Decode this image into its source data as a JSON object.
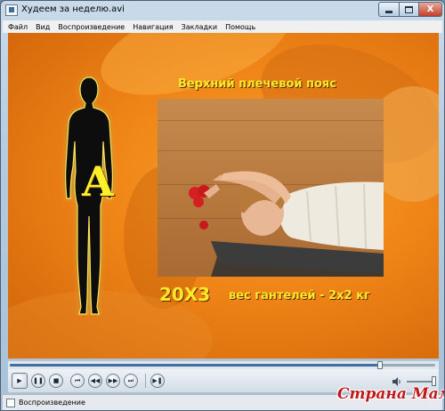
{
  "window": {
    "title": "Худеем за неделю.avi",
    "buttons": {
      "minimize": "—",
      "maximize": "□",
      "close": "X"
    }
  },
  "menu": {
    "items": [
      "Файл",
      "Вид",
      "Воспроизведение",
      "Навигация",
      "Закладки",
      "Помощь"
    ]
  },
  "video": {
    "heading": "Верхний плечевой пояс",
    "figure_letter": "A",
    "sets": "20Х3",
    "weight_text": "вес гантелей - 2х2 кг"
  },
  "playback": {
    "progress": 0.87,
    "volume": 1.0,
    "controls": [
      "play",
      "pause",
      "stop",
      "skip-back",
      "rewind",
      "fast-forward",
      "skip-forward",
      "frame-step"
    ]
  },
  "status": {
    "text": "Воспроизведение"
  },
  "watermark": "Страна Мам",
  "colors": {
    "caption": "#ffe82a",
    "background": "#ef8417",
    "watermark": "#c01818"
  }
}
